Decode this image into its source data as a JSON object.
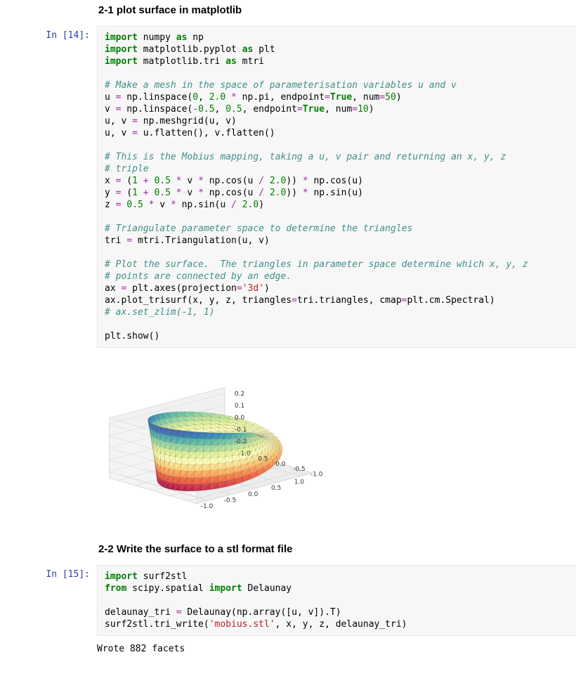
{
  "headings": {
    "h21": "2-1 plot surface in matplotlib",
    "h22": "2-2 Write the surface to a stl format file"
  },
  "prompts": {
    "cell1": "In [14]:",
    "cell2": "In [15]:"
  },
  "code": {
    "cell1": [
      {
        "t": "kw",
        "v": "import"
      },
      {
        "t": "nm",
        "v": " numpy "
      },
      {
        "t": "kw",
        "v": "as"
      },
      {
        "t": "nm",
        "v": " np\n"
      },
      {
        "t": "kw",
        "v": "import"
      },
      {
        "t": "nm",
        "v": " matplotlib.pyplot "
      },
      {
        "t": "kw",
        "v": "as"
      },
      {
        "t": "nm",
        "v": " plt\n"
      },
      {
        "t": "kw",
        "v": "import"
      },
      {
        "t": "nm",
        "v": " matplotlib.tri "
      },
      {
        "t": "kw",
        "v": "as"
      },
      {
        "t": "nm",
        "v": " mtri\n"
      },
      {
        "t": "nm",
        "v": "\n"
      },
      {
        "t": "cmt",
        "v": "# Make a mesh in the space of parameterisation variables u and v"
      },
      {
        "t": "nm",
        "v": "\n"
      },
      {
        "t": "nm",
        "v": "u "
      },
      {
        "t": "op",
        "v": "="
      },
      {
        "t": "nm",
        "v": " np.linspace("
      },
      {
        "t": "num",
        "v": "0"
      },
      {
        "t": "nm",
        "v": ", "
      },
      {
        "t": "num",
        "v": "2.0"
      },
      {
        "t": "nm",
        "v": " "
      },
      {
        "t": "op",
        "v": "*"
      },
      {
        "t": "nm",
        "v": " np.pi, endpoint"
      },
      {
        "t": "op",
        "v": "="
      },
      {
        "t": "kc",
        "v": "True"
      },
      {
        "t": "nm",
        "v": ", num"
      },
      {
        "t": "op",
        "v": "="
      },
      {
        "t": "num",
        "v": "50"
      },
      {
        "t": "nm",
        "v": ")\n"
      },
      {
        "t": "nm",
        "v": "v "
      },
      {
        "t": "op",
        "v": "="
      },
      {
        "t": "nm",
        "v": " np.linspace("
      },
      {
        "t": "op",
        "v": "-"
      },
      {
        "t": "num",
        "v": "0.5"
      },
      {
        "t": "nm",
        "v": ", "
      },
      {
        "t": "num",
        "v": "0.5"
      },
      {
        "t": "nm",
        "v": ", endpoint"
      },
      {
        "t": "op",
        "v": "="
      },
      {
        "t": "kc",
        "v": "True"
      },
      {
        "t": "nm",
        "v": ", num"
      },
      {
        "t": "op",
        "v": "="
      },
      {
        "t": "num",
        "v": "10"
      },
      {
        "t": "nm",
        "v": ")\n"
      },
      {
        "t": "nm",
        "v": "u, v "
      },
      {
        "t": "op",
        "v": "="
      },
      {
        "t": "nm",
        "v": " np.meshgrid(u, v)\n"
      },
      {
        "t": "nm",
        "v": "u, v "
      },
      {
        "t": "op",
        "v": "="
      },
      {
        "t": "nm",
        "v": " u.flatten(), v.flatten()\n"
      },
      {
        "t": "nm",
        "v": "\n"
      },
      {
        "t": "cmt",
        "v": "# This is the Mobius mapping, taking a u, v pair and returning an x, y, z"
      },
      {
        "t": "nm",
        "v": "\n"
      },
      {
        "t": "cmt",
        "v": "# triple"
      },
      {
        "t": "nm",
        "v": "\n"
      },
      {
        "t": "nm",
        "v": "x "
      },
      {
        "t": "op",
        "v": "="
      },
      {
        "t": "nm",
        "v": " ("
      },
      {
        "t": "num",
        "v": "1"
      },
      {
        "t": "nm",
        "v": " "
      },
      {
        "t": "op",
        "v": "+"
      },
      {
        "t": "nm",
        "v": " "
      },
      {
        "t": "num",
        "v": "0.5"
      },
      {
        "t": "nm",
        "v": " "
      },
      {
        "t": "op",
        "v": "*"
      },
      {
        "t": "nm",
        "v": " v "
      },
      {
        "t": "op",
        "v": "*"
      },
      {
        "t": "nm",
        "v": " np.cos(u "
      },
      {
        "t": "op",
        "v": "/"
      },
      {
        "t": "nm",
        "v": " "
      },
      {
        "t": "num",
        "v": "2.0"
      },
      {
        "t": "nm",
        "v": ")) "
      },
      {
        "t": "op",
        "v": "*"
      },
      {
        "t": "nm",
        "v": " np.cos(u)\n"
      },
      {
        "t": "nm",
        "v": "y "
      },
      {
        "t": "op",
        "v": "="
      },
      {
        "t": "nm",
        "v": " ("
      },
      {
        "t": "num",
        "v": "1"
      },
      {
        "t": "nm",
        "v": " "
      },
      {
        "t": "op",
        "v": "+"
      },
      {
        "t": "nm",
        "v": " "
      },
      {
        "t": "num",
        "v": "0.5"
      },
      {
        "t": "nm",
        "v": " "
      },
      {
        "t": "op",
        "v": "*"
      },
      {
        "t": "nm",
        "v": " v "
      },
      {
        "t": "op",
        "v": "*"
      },
      {
        "t": "nm",
        "v": " np.cos(u "
      },
      {
        "t": "op",
        "v": "/"
      },
      {
        "t": "nm",
        "v": " "
      },
      {
        "t": "num",
        "v": "2.0"
      },
      {
        "t": "nm",
        "v": ")) "
      },
      {
        "t": "op",
        "v": "*"
      },
      {
        "t": "nm",
        "v": " np.sin(u)\n"
      },
      {
        "t": "nm",
        "v": "z "
      },
      {
        "t": "op",
        "v": "="
      },
      {
        "t": "nm",
        "v": " "
      },
      {
        "t": "num",
        "v": "0.5"
      },
      {
        "t": "nm",
        "v": " "
      },
      {
        "t": "op",
        "v": "*"
      },
      {
        "t": "nm",
        "v": " v "
      },
      {
        "t": "op",
        "v": "*"
      },
      {
        "t": "nm",
        "v": " np.sin(u "
      },
      {
        "t": "op",
        "v": "/"
      },
      {
        "t": "nm",
        "v": " "
      },
      {
        "t": "num",
        "v": "2.0"
      },
      {
        "t": "nm",
        "v": ")\n"
      },
      {
        "t": "nm",
        "v": "\n"
      },
      {
        "t": "cmt",
        "v": "# Triangulate parameter space to determine the triangles"
      },
      {
        "t": "nm",
        "v": "\n"
      },
      {
        "t": "nm",
        "v": "tri "
      },
      {
        "t": "op",
        "v": "="
      },
      {
        "t": "nm",
        "v": " mtri.Triangulation(u, v)\n"
      },
      {
        "t": "nm",
        "v": "\n"
      },
      {
        "t": "cmt",
        "v": "# Plot the surface.  The triangles in parameter space determine which x, y, z"
      },
      {
        "t": "nm",
        "v": "\n"
      },
      {
        "t": "cmt",
        "v": "# points are connected by an edge."
      },
      {
        "t": "nm",
        "v": "\n"
      },
      {
        "t": "nm",
        "v": "ax "
      },
      {
        "t": "op",
        "v": "="
      },
      {
        "t": "nm",
        "v": " plt.axes(projection"
      },
      {
        "t": "op",
        "v": "="
      },
      {
        "t": "str",
        "v": "'3d'"
      },
      {
        "t": "nm",
        "v": ")\n"
      },
      {
        "t": "nm",
        "v": "ax.plot_trisurf(x, y, z, triangles"
      },
      {
        "t": "op",
        "v": "="
      },
      {
        "t": "nm",
        "v": "tri.triangles, cmap"
      },
      {
        "t": "op",
        "v": "="
      },
      {
        "t": "nm",
        "v": "plt.cm.Spectral)\n"
      },
      {
        "t": "cmt",
        "v": "# ax.set_zlim(-1, 1)"
      },
      {
        "t": "nm",
        "v": "\n"
      },
      {
        "t": "nm",
        "v": "\n"
      },
      {
        "t": "nm",
        "v": "plt.show()"
      }
    ],
    "cell2": [
      {
        "t": "kw",
        "v": "import"
      },
      {
        "t": "nm",
        "v": " surf2stl\n"
      },
      {
        "t": "kw",
        "v": "from"
      },
      {
        "t": "nm",
        "v": " scipy.spatial "
      },
      {
        "t": "kw",
        "v": "import"
      },
      {
        "t": "nm",
        "v": " Delaunay\n"
      },
      {
        "t": "nm",
        "v": "\n"
      },
      {
        "t": "nm",
        "v": "delaunay_tri "
      },
      {
        "t": "op",
        "v": "="
      },
      {
        "t": "nm",
        "v": " Delaunay(np.array([u, v]).T)\n"
      },
      {
        "t": "nm",
        "v": "surf2stl.tri_write("
      },
      {
        "t": "str",
        "v": "'mobius.stl'"
      },
      {
        "t": "nm",
        "v": ", x, y, z, delaunay_tri)"
      }
    ]
  },
  "output": {
    "cell2": "Wrote 882 facets"
  },
  "chart_data": {
    "type": "surface3d",
    "title": "",
    "description": "Möbius strip triangulated surface colored with Spectral colormap",
    "x_ticks": [
      -1.0,
      -0.5,
      0.0,
      0.5,
      1.0
    ],
    "y_ticks": [
      -1.0,
      -0.5,
      0.0,
      0.5,
      1.0
    ],
    "z_ticks": [
      -0.2,
      -0.1,
      0.0,
      0.1,
      0.2
    ],
    "xlim": [
      -1.25,
      1.25
    ],
    "ylim": [
      -1.25,
      1.25
    ],
    "zlim": [
      -0.25,
      0.25
    ],
    "colormap": "Spectral",
    "u_range": [
      0,
      6.283185307179586
    ],
    "v_range": [
      -0.5,
      0.5
    ],
    "u_num": 50,
    "v_num": 10,
    "equations": {
      "x": "(1 + 0.5*v*cos(u/2)) * cos(u)",
      "y": "(1 + 0.5*v*cos(u/2)) * sin(u)",
      "z": "0.5*v*sin(u/2)"
    }
  }
}
